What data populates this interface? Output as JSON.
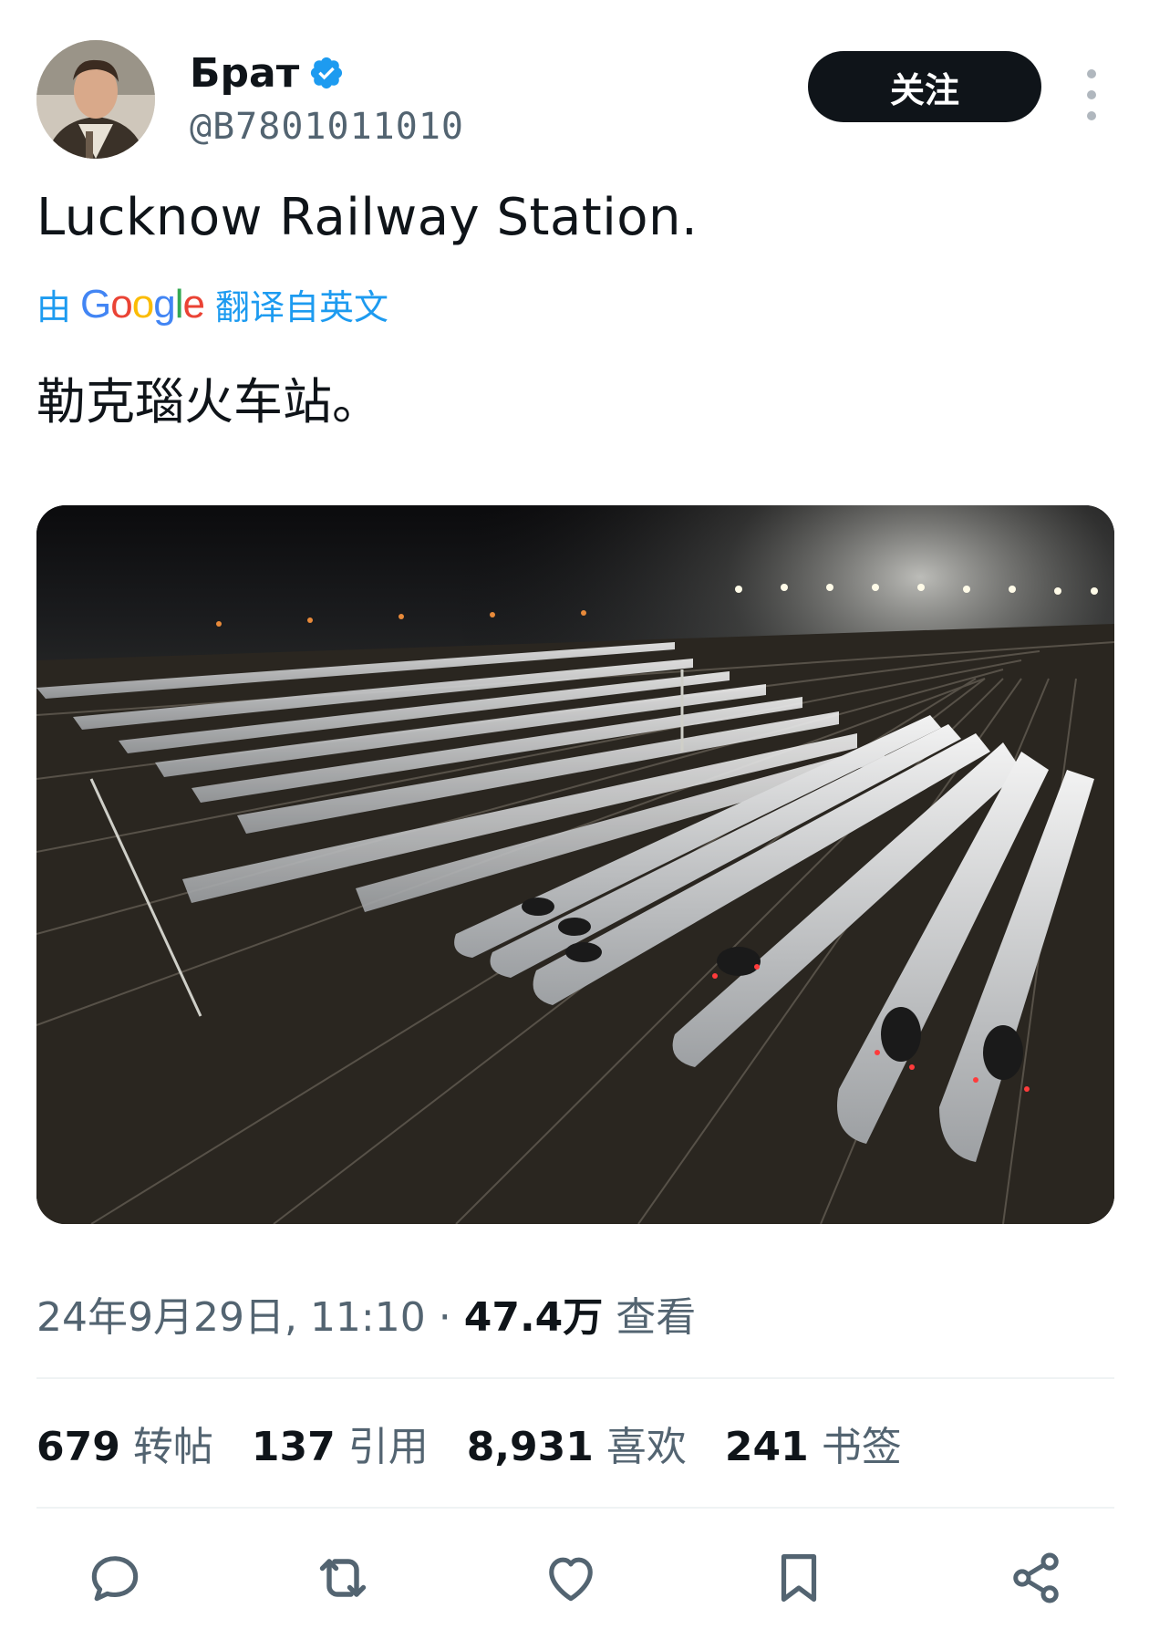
{
  "author": {
    "display_name": "Брат",
    "handle": "@B7801011010",
    "avatar_icon": "user-avatar-photo",
    "verified_icon": "verified-badge-icon"
  },
  "follow_label": "关注",
  "more_icon": "more-vertical-icon",
  "tweet": {
    "text": "Lucknow Railway Station.",
    "translation_prefix": "由",
    "translation_brand": "Google",
    "translation_suffix": "翻译自英文",
    "translated_text": "勒克瑙火车站。"
  },
  "media": {
    "image_icon": "photo-high-speed-trains-depot-night"
  },
  "meta": {
    "timestamp": "24年9月29日, 11:10 ·",
    "views_count": "47.4万",
    "views_label": "查看"
  },
  "stats": [
    {
      "num": "679",
      "label": "转帖"
    },
    {
      "num": "137",
      "label": "引用"
    },
    {
      "num": "8,931",
      "label": "喜欢"
    },
    {
      "num": "241",
      "label": "书签"
    }
  ],
  "actions": [
    {
      "icon": "reply-icon"
    },
    {
      "icon": "retweet-icon"
    },
    {
      "icon": "like-icon"
    },
    {
      "icon": "bookmark-icon"
    },
    {
      "icon": "share-icon"
    }
  ],
  "colors": {
    "accent": "#1d9bf0",
    "text": "#0f1419",
    "secondary": "#536471",
    "follow_bg": "#0f1419"
  }
}
